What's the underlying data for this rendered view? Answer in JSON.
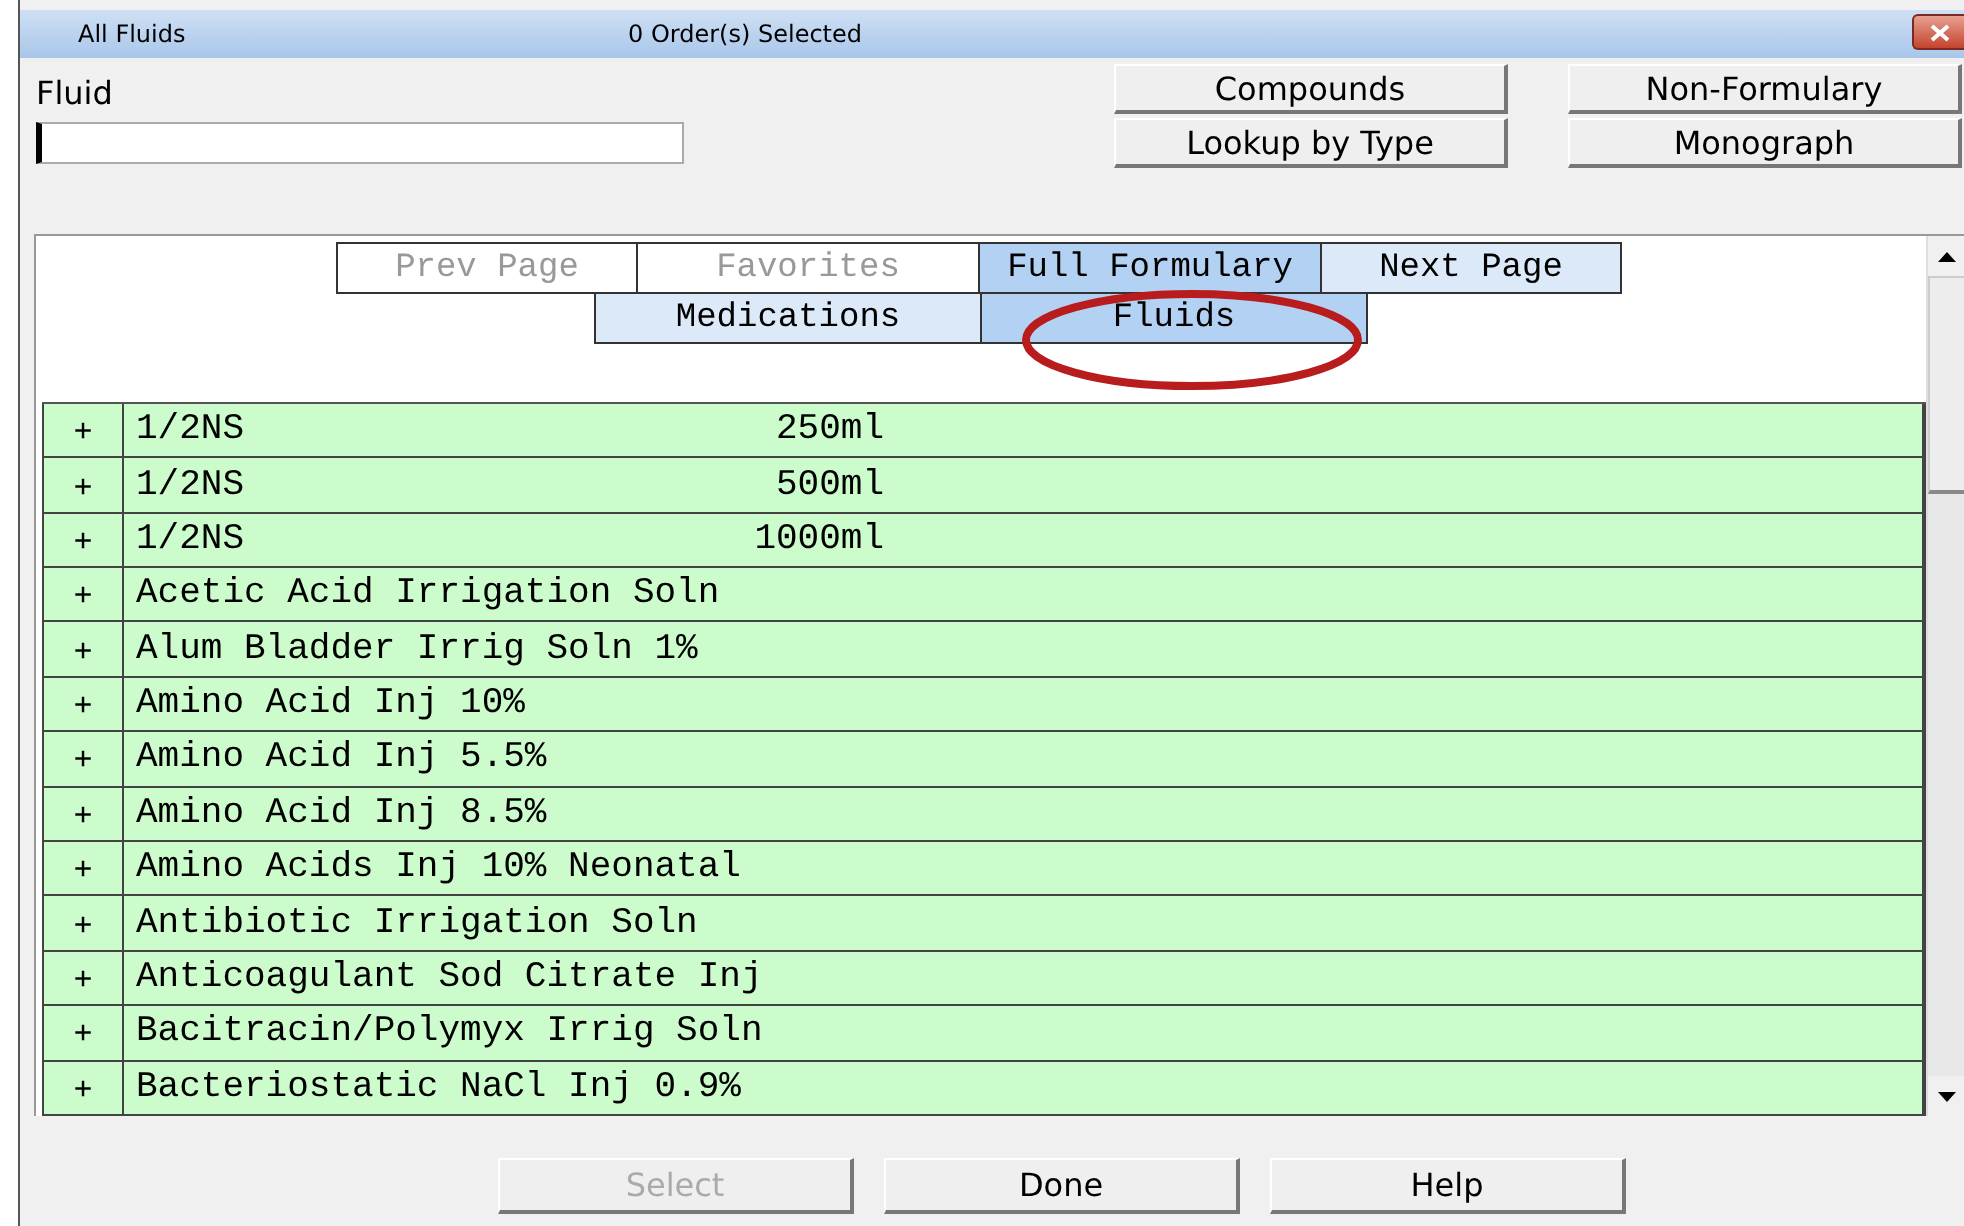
{
  "window": {
    "title": "All Fluids",
    "status": "0 Order(s) Selected"
  },
  "search": {
    "label": "Fluid"
  },
  "top_buttons": [
    {
      "label": "Compounds"
    },
    {
      "label": "Non-Formulary"
    },
    {
      "label": "Lookup by Type"
    },
    {
      "label": "Monograph"
    }
  ],
  "tabs_row_1": [
    {
      "label": "Prev Page",
      "selected": false,
      "disabled": true
    },
    {
      "label": "Favorites",
      "selected": false,
      "disabled": true
    },
    {
      "label": "Full Formulary",
      "selected": true,
      "disabled": false
    },
    {
      "label": "Next Page",
      "selected": false,
      "disabled": false
    }
  ],
  "tabs_row_2": [
    {
      "label": "Medications",
      "selected": false,
      "disabled": false
    },
    {
      "label": "Fluids",
      "selected": true,
      "disabled": false
    }
  ],
  "rows": [
    {
      "expander": "+",
      "name": "1/2NS",
      "volume": "250ml"
    },
    {
      "expander": "+",
      "name": "1/2NS",
      "volume": "500ml"
    },
    {
      "expander": "+",
      "name": "1/2NS",
      "volume": "1000ml"
    },
    {
      "expander": "+",
      "name": "Acetic Acid Irrigation Soln"
    },
    {
      "expander": "+",
      "name": "Alum Bladder Irrig Soln 1%"
    },
    {
      "expander": "+",
      "name": "Amino Acid Inj 10%"
    },
    {
      "expander": "+",
      "name": "Amino Acid Inj 5.5%"
    },
    {
      "expander": "+",
      "name": "Amino Acid Inj 8.5%"
    },
    {
      "expander": "+",
      "name": "Amino Acids Inj 10% Neonatal"
    },
    {
      "expander": "+",
      "name": "Antibiotic Irrigation Soln"
    },
    {
      "expander": "+",
      "name": "Anticoagulant Sod Citrate Inj"
    },
    {
      "expander": "+",
      "name": "Bacitracin/Polymyx Irrig Soln"
    },
    {
      "expander": "+",
      "name": "Bacteriostatic NaCl Inj 0.9%"
    }
  ],
  "bottom_buttons": [
    {
      "label": "Select",
      "disabled": true
    },
    {
      "label": "Done",
      "disabled": false
    },
    {
      "label": "Help",
      "disabled": false
    }
  ]
}
